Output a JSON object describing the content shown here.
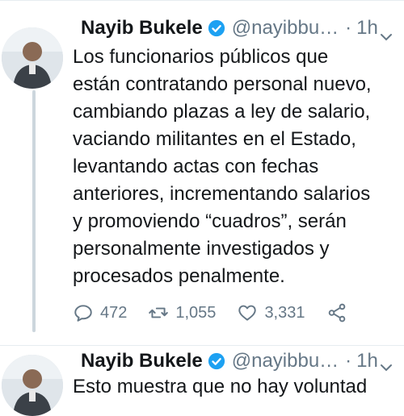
{
  "tweets": [
    {
      "author": {
        "name": "Nayib Bukele",
        "handle": "@nayibbu…",
        "verified": true
      },
      "dot": "·",
      "time": "1h",
      "text": "Los funcionarios públicos que\nestán contratando personal nuevo,\ncambiando plazas a ley de salario,\nvaciando militantes en el Estado,\nlevantando actas con fechas\nanteriores, incrementando salarios\ny promoviendo “cuadros”, serán\npersonalmente investigados y\nprocesados penalmente.",
      "actions": {
        "replies": "472",
        "retweets": "1,055",
        "likes": "3,331"
      }
    },
    {
      "author": {
        "name": "Nayib Bukele",
        "handle": "@nayibbu…",
        "verified": true
      },
      "dot": "·",
      "time": "1h",
      "text": "Esto muestra que no hay voluntad"
    }
  ],
  "icons": {
    "verified": "verified-badge-icon",
    "caret": "chevron-down-icon",
    "reply": "reply-icon",
    "retweet": "retweet-icon",
    "like": "heart-icon",
    "share": "share-icon"
  },
  "colors": {
    "verified": "#1da1f2",
    "muted": "#657786",
    "text": "#14171a"
  }
}
